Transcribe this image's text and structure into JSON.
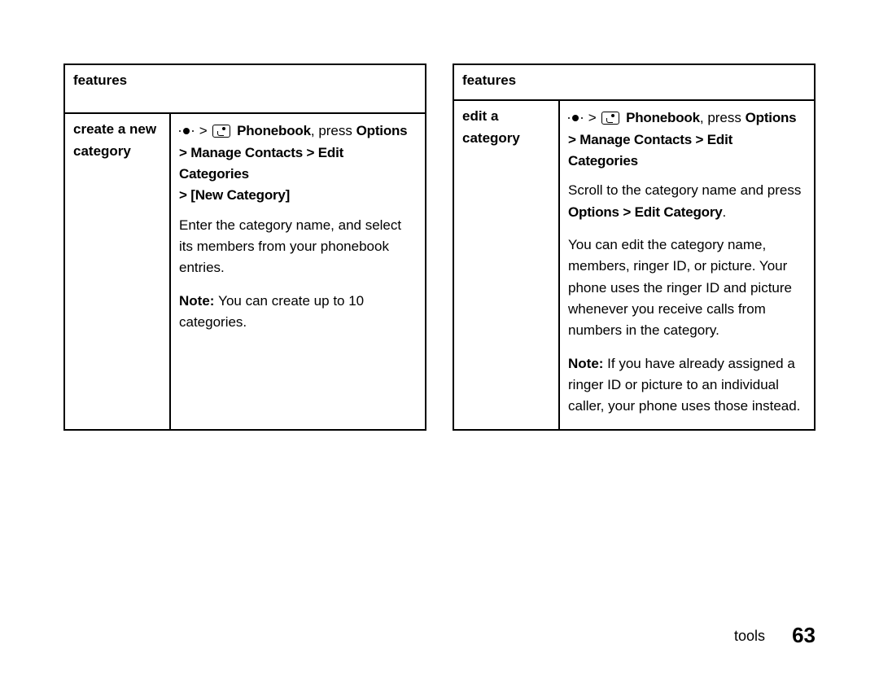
{
  "left": {
    "header": "features",
    "row_label": "create a new category",
    "nav": {
      "phonebook": "Phonebook",
      "press": ", press ",
      "options": "Options",
      "path2": "> Manage Contacts > Edit Categories",
      "path3": "> [New Category]"
    },
    "body1": "Enter the category name, and select its members from your phonebook entries.",
    "note_label": "Note: ",
    "note_text": "You can create up to 10 categories."
  },
  "right": {
    "header": "features",
    "row_label": "edit a category",
    "nav": {
      "phonebook": "Phonebook",
      "press": ", press ",
      "options": "Options",
      "path2": "> Manage Contacts > Edit Categories"
    },
    "body1_a": "Scroll to the category name and press ",
    "body1_b": "Options > Edit Category",
    "body1_c": ".",
    "body2": "You can edit the category name, members, ringer ID, or picture. Your phone uses the ringer ID and picture whenever you receive calls from numbers in the category.",
    "note_label": "Note: ",
    "note_text": "If you have already assigned a ringer ID or picture to an individual caller, your phone uses those instead."
  },
  "footer": {
    "section": "tools",
    "page": "63"
  }
}
